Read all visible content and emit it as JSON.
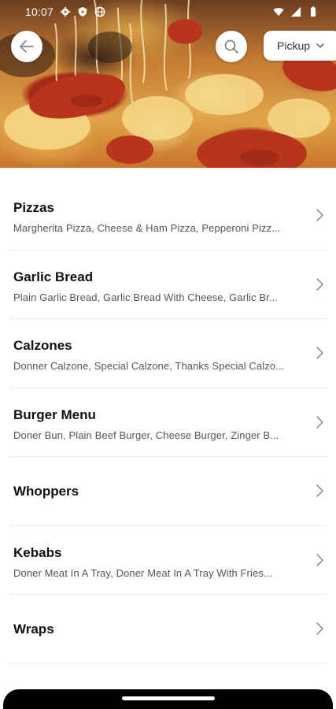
{
  "status_bar": {
    "time": "10:07",
    "left_icons": [
      "gear-icon",
      "shield-icon",
      "globe-icon"
    ],
    "right_icons": [
      "wifi-icon",
      "signal-icon",
      "battery-icon"
    ]
  },
  "header": {
    "back_icon": "back-arrow-icon",
    "search_icon": "search-icon",
    "order_mode": {
      "label": "Pickup",
      "icon": "chevron-down-icon"
    }
  },
  "menu": {
    "categories": [
      {
        "title": "Pizzas",
        "description": "Margherita Pizza, Cheese & Ham Pizza, Pepperoni Pizz..."
      },
      {
        "title": "Garlic Bread",
        "description": "Plain Garlic Bread, Garlic Bread With Cheese, Garlic Br..."
      },
      {
        "title": "Calzones",
        "description": "Donner Calzone, Special Calzone, Thanks Special Calzo..."
      },
      {
        "title": "Burger Menu",
        "description": "Doner Bun, Plain Beef Burger, Cheese Burger, Zinger B..."
      },
      {
        "title": "Whoppers",
        "description": ""
      },
      {
        "title": "Kebabs",
        "description": "Doner Meat In A Tray, Doner Meat In A Tray With Fries..."
      },
      {
        "title": "Wraps",
        "description": ""
      }
    ],
    "chevron_icon": "chevron-right-icon"
  },
  "colors": {
    "title_text": "#111111",
    "description_text": "#555555",
    "divider": "#ececec",
    "nav_bar": "#000000"
  }
}
